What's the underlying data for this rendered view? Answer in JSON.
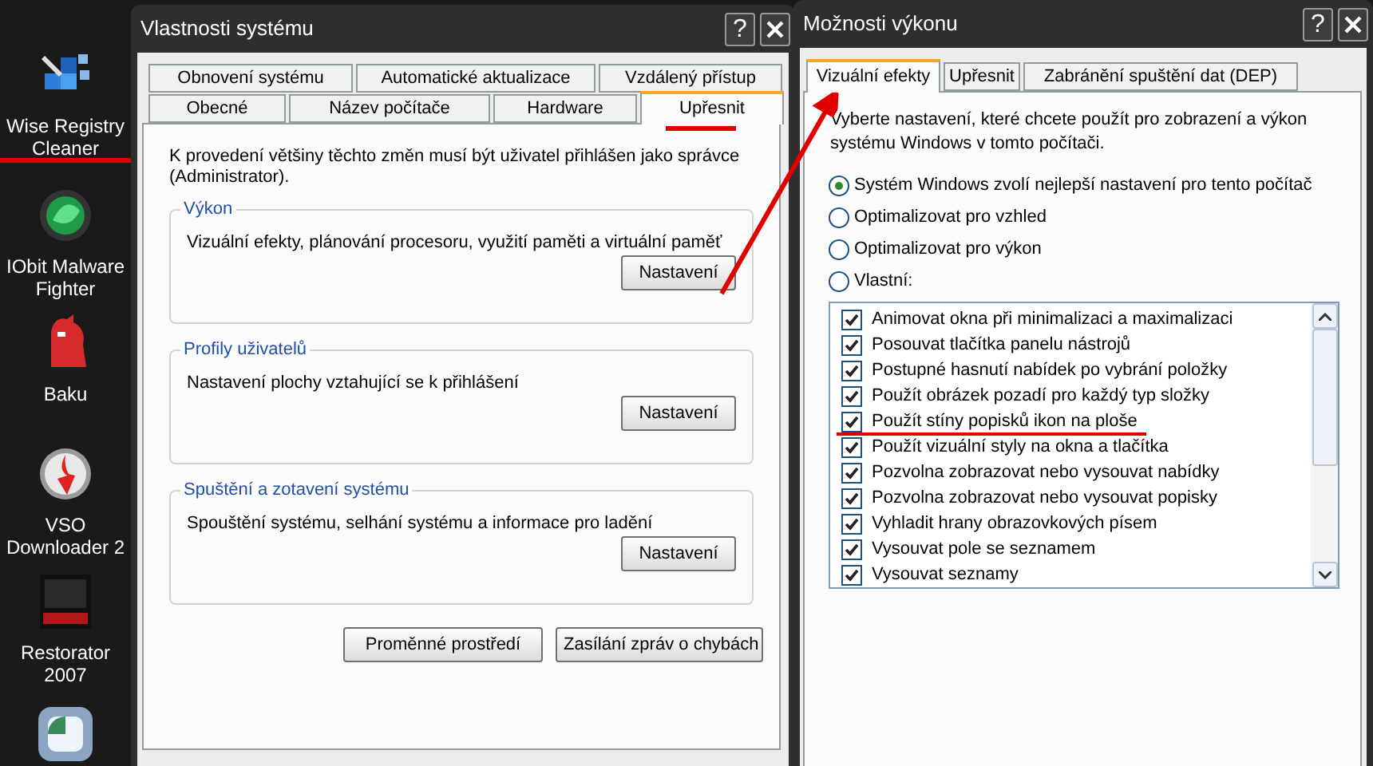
{
  "desktop_icons": [
    {
      "kind": "blocks",
      "label": "Wise Registry Cleaner"
    },
    {
      "kind": "orb",
      "label": "IObit Malware Fighter"
    },
    {
      "kind": "creature",
      "label": "Baku"
    },
    {
      "kind": "disc",
      "label": "VSO Downloader 2"
    },
    {
      "kind": "res",
      "label": "Restorator 2007"
    },
    {
      "kind": "square"
    }
  ],
  "system_properties": {
    "title": "Vlastnosti systému",
    "help_button": "?",
    "tabs_row_1": [
      {
        "label": "Obnovení systému",
        "selected": false
      },
      {
        "label": "Automatické aktualizace",
        "selected": false
      },
      {
        "label": "Vzdálený přístup",
        "selected": false
      }
    ],
    "tabs_row_2": [
      {
        "label": "Obecné",
        "selected": false
      },
      {
        "label": "Název počítače",
        "selected": false
      },
      {
        "label": "Hardware",
        "selected": false
      },
      {
        "label": "Upřesnit",
        "selected": true
      }
    ],
    "intro": "K provedení většiny těchto změn musí být uživatel přihlášen jako správce (Administrator).",
    "groups": [
      {
        "title": "Výkon",
        "description": "Vizuální efekty, plánování procesoru, využití paměti a virtuální paměť",
        "button": "Nastavení"
      },
      {
        "title": "Profily uživatelů",
        "description": "Nastavení plochy vztahující se k přihlášení",
        "button": "Nastavení"
      },
      {
        "title": "Spuštění a zotavení systému",
        "description": "Spouštění systému, selhání systému a informace pro ladění",
        "button": "Nastavení"
      }
    ],
    "buttons": [
      "Proměnné prostředí",
      "Zasílání zpráv o chybách"
    ]
  },
  "performance_options": {
    "title": "Možnosti výkonu",
    "help_button": "?",
    "tabs": [
      {
        "label": "Vizuální efekty",
        "selected": true
      },
      {
        "label": "Upřesnit",
        "selected": false
      },
      {
        "label": "Zabránění spuštění dat (DEP)",
        "selected": false
      }
    ],
    "description": "Vyberte nastavení, které chcete použít pro zobrazení a výkon systému Windows v tomto počítači.",
    "options": [
      {
        "label": "Systém Windows zvolí nejlepší nastavení pro tento počítač",
        "selected": true
      },
      {
        "label": "Optimalizovat pro vzhled",
        "selected": false
      },
      {
        "label": "Optimalizovat pro výkon",
        "selected": false
      },
      {
        "label": "Vlastní:",
        "selected": false
      }
    ],
    "effects": [
      {
        "label": "Animovat okna při minimalizaci a maximalizaci",
        "checked": true
      },
      {
        "label": "Posouvat tlačítka panelu nástrojů",
        "checked": true
      },
      {
        "label": "Postupné hasnutí nabídek po vybrání položky",
        "checked": true
      },
      {
        "label": "Použít obrázek pozadí pro každý typ složky",
        "checked": true
      },
      {
        "label": "Použít stíny popisků ikon na ploše",
        "checked": true
      },
      {
        "label": "Použít vizuální styly na okna a tlačítka",
        "checked": true
      },
      {
        "label": "Pozvolna zobrazovat nebo vysouvat nabídky",
        "checked": true
      },
      {
        "label": "Pozvolna zobrazovat nebo vysouvat popisky",
        "checked": true
      },
      {
        "label": "Vyhladit hrany obrazovkových písem",
        "checked": true
      },
      {
        "label": "Vysouvat pole se seznamem",
        "checked": true
      },
      {
        "label": "Vysouvat seznamy",
        "checked": true
      }
    ]
  }
}
